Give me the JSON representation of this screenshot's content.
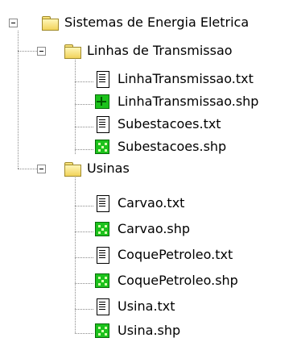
{
  "tree": {
    "root": {
      "label": "Sistemas de Energia Eletrica",
      "icon": "folder-icon",
      "expanded": true,
      "children": [
        {
          "label": "Linhas de Transmissao",
          "icon": "folder-icon",
          "expanded": true,
          "files": [
            {
              "label": "LinhaTransmissao.txt",
              "icon": "text-file-icon"
            },
            {
              "label": "LinhaTransmissao.shp",
              "icon": "line-shapefile-icon"
            },
            {
              "label": "Subestacoes.txt",
              "icon": "text-file-icon"
            },
            {
              "label": "Subestacoes.shp",
              "icon": "point-shapefile-icon"
            }
          ]
        },
        {
          "label": "Usinas",
          "icon": "folder-icon",
          "expanded": true,
          "files": [
            {
              "label": "Carvao.txt",
              "icon": "text-file-icon"
            },
            {
              "label": "Carvao.shp",
              "icon": "point-shapefile-icon"
            },
            {
              "label": "CoquePetroleo.txt",
              "icon": "text-file-icon"
            },
            {
              "label": "CoquePetroleo.shp",
              "icon": "point-shapefile-icon"
            },
            {
              "label": "Usina.txt",
              "icon": "text-file-icon"
            },
            {
              "label": "Usina.shp",
              "icon": "point-shapefile-icon"
            }
          ]
        }
      ]
    }
  },
  "colors": {
    "shapefile_green": "#1cc21c",
    "folder_yellow": "#f1d35a",
    "tree_line": "#8a8a8a"
  }
}
